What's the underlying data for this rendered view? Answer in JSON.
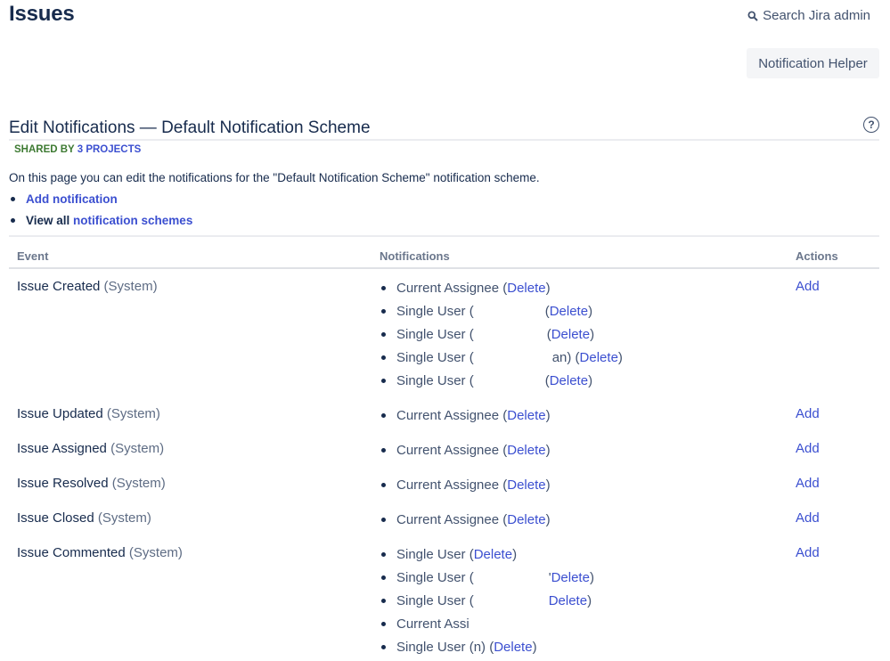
{
  "header": {
    "title": "Issues",
    "search_label": "Search Jira admin",
    "helper_button": "Notification Helper"
  },
  "section": {
    "title": "Edit Notifications — Default Notification Scheme",
    "shared_label": "SHARED BY",
    "shared_link": "3 PROJECTS",
    "description": "On this page you can edit the notifications for the \"Default Notification Scheme\" notification scheme.",
    "add_notification": "Add notification",
    "view_all_prefix": "View all",
    "view_all_link": "notification schemes"
  },
  "table": {
    "columns": [
      "Event",
      "Notifications",
      "Actions"
    ],
    "rows": [
      {
        "event": "Issue Created",
        "event_type": "(System)",
        "action": "Add",
        "notifications": [
          {
            "text": "Current Assignee (",
            "suffix": "",
            "delete": "Delete",
            "close": ")"
          },
          {
            "text": "Single User (",
            "suffix": "(",
            "delete": "Delete",
            "close": ")"
          },
          {
            "text": "Single User (",
            "suffix": "(",
            "delete": "Delete",
            "close": ")"
          },
          {
            "text": "Single User (",
            "suffix": "an) (",
            "delete": "Delete",
            "close": ")"
          },
          {
            "text": "Single User (",
            "suffix": "(",
            "delete": "Delete",
            "close": ")"
          }
        ]
      },
      {
        "event": "Issue Updated",
        "event_type": "(System)",
        "action": "Add",
        "notifications": [
          {
            "text": "Current Assignee (",
            "suffix": "",
            "delete": "Delete",
            "close": ")"
          }
        ]
      },
      {
        "event": "Issue Assigned",
        "event_type": "(System)",
        "action": "Add",
        "notifications": [
          {
            "text": "Current Assignee (",
            "suffix": "",
            "delete": "Delete",
            "close": ")"
          }
        ]
      },
      {
        "event": "Issue Resolved",
        "event_type": "(System)",
        "action": "Add",
        "notifications": [
          {
            "text": "Current Assignee (",
            "suffix": "",
            "delete": "Delete",
            "close": ")"
          }
        ]
      },
      {
        "event": "Issue Closed",
        "event_type": "(System)",
        "action": "Add",
        "notifications": [
          {
            "text": "Current Assignee (",
            "suffix": "",
            "delete": "Delete",
            "close": ")"
          }
        ]
      },
      {
        "event": "Issue Commented",
        "event_type": "(System)",
        "action": "Add",
        "notifications": [
          {
            "text": "Single User (",
            "suffix": "",
            "delete": "Delete",
            "close": ")"
          },
          {
            "text": "Single User (",
            "suffix": "'",
            "delete": "Delete",
            "close": ")"
          },
          {
            "text": "Single User (",
            "suffix": "",
            "delete": "Delete",
            "close": ")"
          },
          {
            "text": "Current Assi",
            "suffix": "",
            "delete": "",
            "close": ""
          },
          {
            "text": "Single User (",
            "suffix": "n) (",
            "delete": "Delete",
            "close": ")"
          }
        ]
      }
    ]
  }
}
